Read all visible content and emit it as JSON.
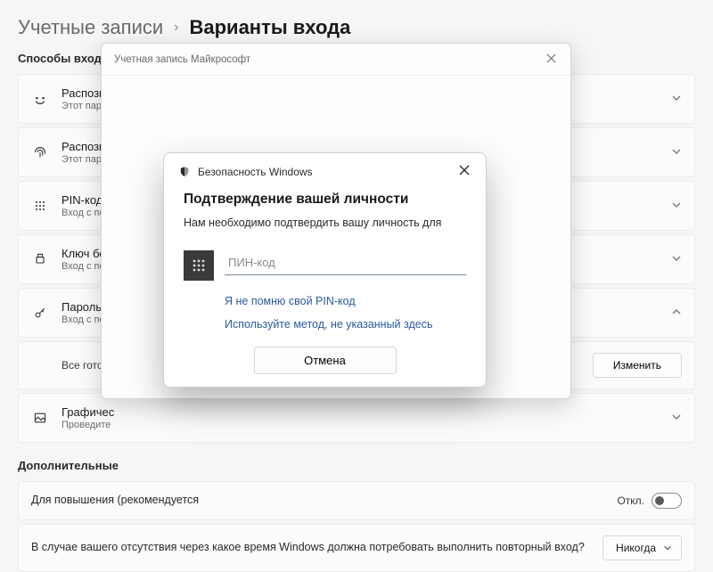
{
  "breadcrumb": {
    "parent": "Учетные записи",
    "current": "Варианты входа"
  },
  "sections": {
    "methods_title": "Способы входа",
    "additional_title": "Дополнительные"
  },
  "items": [
    {
      "title": "Распозна",
      "desc": "Этот парам"
    },
    {
      "title": "Распозна",
      "desc": "Этот парам"
    },
    {
      "title": "PIN-код (",
      "desc": "Вход с пом"
    },
    {
      "title": "Ключ без",
      "desc": "Вход с пом"
    },
    {
      "title": "Пароль",
      "desc": "Вход с пом"
    },
    {
      "title": "Графичес",
      "desc": "Проведите"
    }
  ],
  "password_sub": {
    "status": "Все готов",
    "change_btn": "Изменить"
  },
  "settings": {
    "hello_only": "Для повышения\n(рекомендуется",
    "hello_toggle_label": "Откл.",
    "reauth": "В случае вашего отсутствия через какое время Windows должна потребовать выполнить повторный вход?",
    "reauth_value": "Никогда"
  },
  "ms_dialog": {
    "title": "Учетная запись Майкрософт"
  },
  "sec_dialog": {
    "title": "Безопасность Windows",
    "heading": "Подтверждение вашей личности",
    "message": "Нам необходимо подтвердить вашу личность для",
    "pin_placeholder": "ПИН-код",
    "forgot": "Я не помню свой PIN-код",
    "other_method": "Используйте метод, не указанный здесь",
    "cancel": "Отмена"
  }
}
